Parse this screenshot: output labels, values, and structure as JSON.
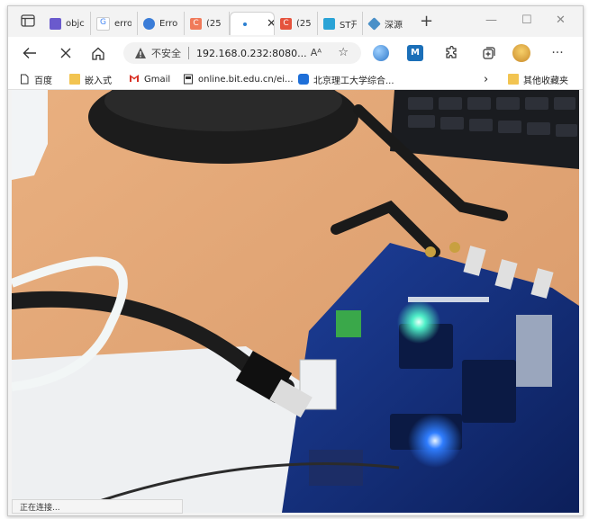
{
  "tabs": [
    {
      "title": "objc",
      "icon": "gear-icon",
      "color": "#6a5acd"
    },
    {
      "title": "erro",
      "icon": "google-icon",
      "color": "#4285f4"
    },
    {
      "title": "Erro",
      "icon": "globe-icon",
      "color": "#3b7dd8"
    },
    {
      "title": "(25",
      "icon": "csdn-icon",
      "color": "#f07a5a"
    },
    {
      "title": "",
      "icon": "loading-icon",
      "color": "#2b7fd1",
      "active": true
    },
    {
      "title": "(25",
      "icon": "csdn-icon",
      "color": "#e5533d"
    },
    {
      "title": "ST开",
      "icon": "bilibili-icon",
      "color": "#2aa3d6"
    },
    {
      "title": "深源",
      "icon": "diamond-icon",
      "color": "#4a90c8"
    }
  ],
  "toolbar": {
    "insecure_label": "不安全",
    "url": "192.168.0.232:8080...",
    "read_aloud": "Aᴬ"
  },
  "bookmarks": [
    {
      "label": "百度",
      "icon": "page-icon"
    },
    {
      "label": "嵌入式",
      "icon": "folder-icon"
    },
    {
      "label": "Gmail",
      "icon": "gmail-icon"
    },
    {
      "label": "online.bit.edu.cn/ei...",
      "icon": "page-icon"
    },
    {
      "label": "北京理工大学综合...",
      "icon": "bit-icon"
    }
  ],
  "other_bookmarks": "其他收藏夹",
  "status": "正在连接..."
}
